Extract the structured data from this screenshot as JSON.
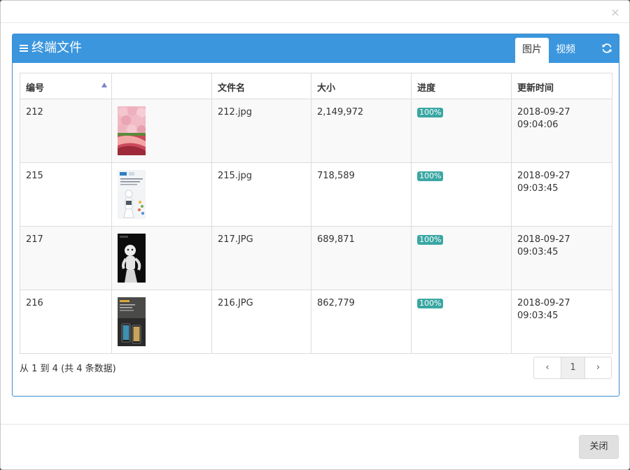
{
  "dialog": {
    "close_glyph": "×",
    "close_button_label": "关闭"
  },
  "panel": {
    "title": "终端文件",
    "title_icon": "menu-icon",
    "tabs": [
      {
        "label": "图片",
        "active": true
      },
      {
        "label": "视频",
        "active": false
      }
    ],
    "refresh_icon": "refresh-icon"
  },
  "table": {
    "headers": [
      "编号",
      "",
      "文件名",
      "大小",
      "进度",
      "更新时间"
    ],
    "sorted_column": "编号",
    "rows": [
      {
        "id": "212",
        "thumb": "pink-roses-image",
        "filename": "212.jpg",
        "size": "2,149,972",
        "progress": "100%",
        "date": "2018-09-27",
        "time": "09:04:06"
      },
      {
        "id": "215",
        "thumb": "robot-poster-light",
        "filename": "215.jpg",
        "size": "718,589",
        "progress": "100%",
        "date": "2018-09-27",
        "time": "09:03:45"
      },
      {
        "id": "217",
        "thumb": "robot-poster-dark",
        "filename": "217.JPG",
        "size": "689,871",
        "progress": "100%",
        "date": "2018-09-27",
        "time": "09:03:45"
      },
      {
        "id": "216",
        "thumb": "phone-poster-dark",
        "filename": "216.JPG",
        "size": "862,779",
        "progress": "100%",
        "date": "2018-09-27",
        "time": "09:03:45"
      }
    ]
  },
  "pagination": {
    "info": "从 1 到 4 (共 4 条数据)",
    "prev": "‹",
    "current": "1",
    "next": "›"
  },
  "colors": {
    "panel_header": "#3b96dd",
    "badge": "#3aa7a3"
  }
}
